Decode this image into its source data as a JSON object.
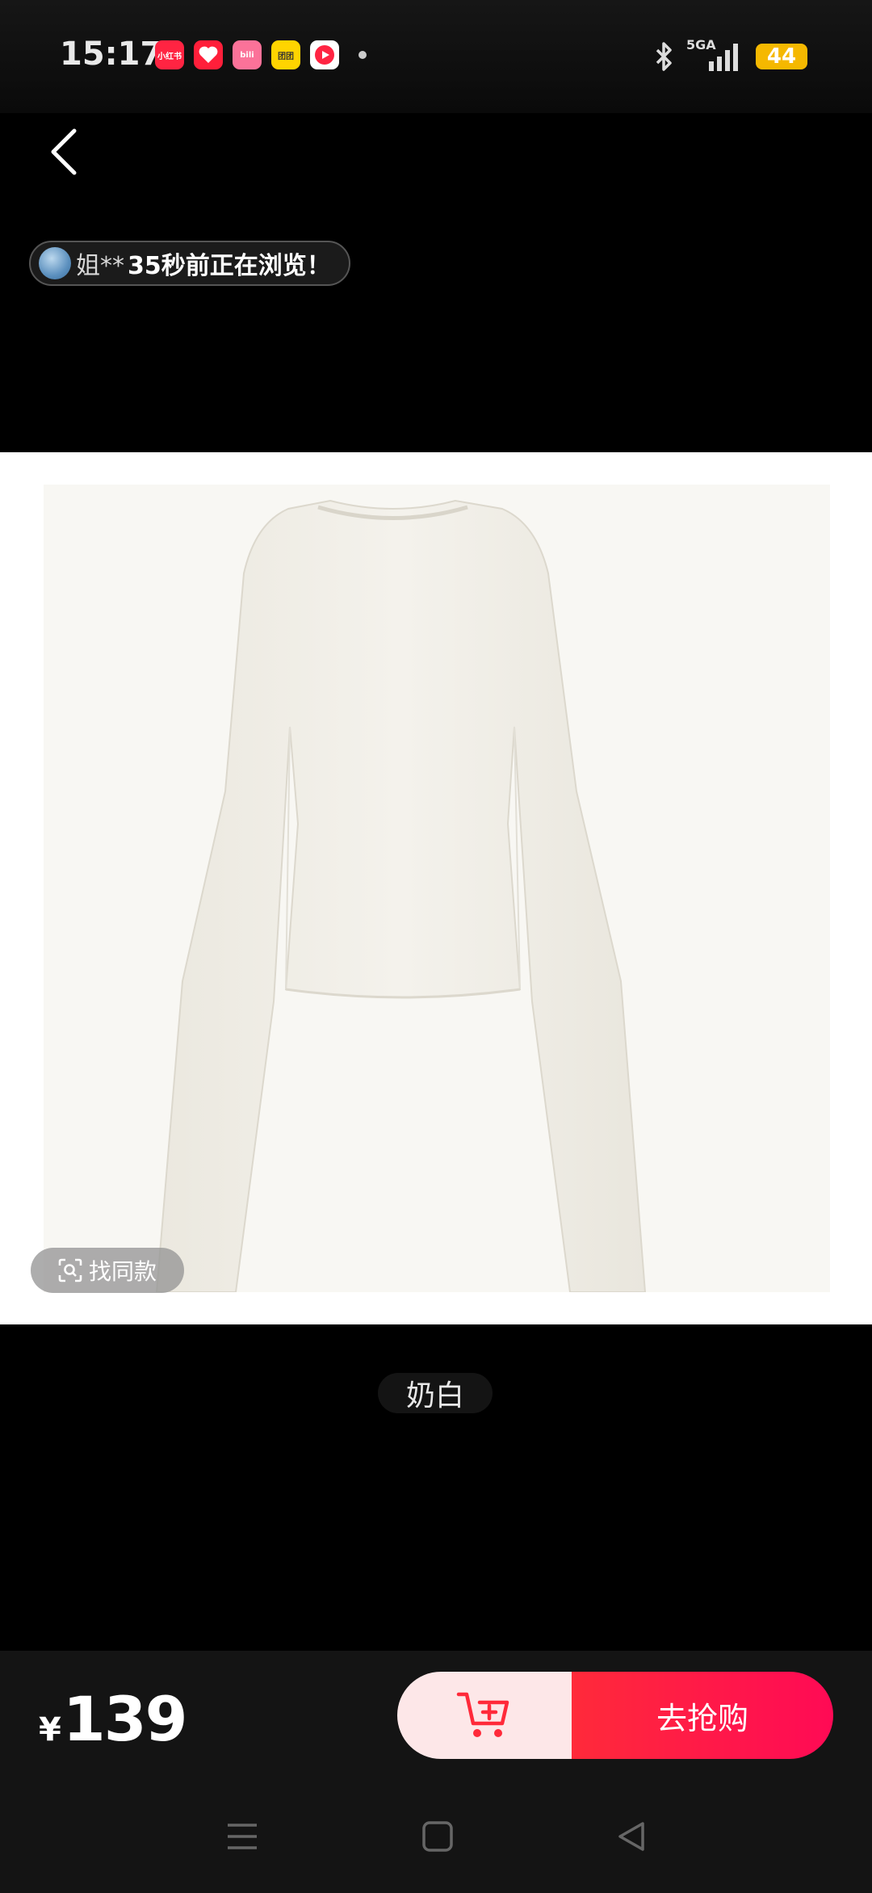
{
  "status_bar": {
    "time": "15:17",
    "apps": [
      {
        "icon": "xiaohongshu-icon",
        "label": "小红书",
        "color": "#ff2442"
      },
      {
        "icon": "heart-app-icon",
        "label": "",
        "color": "#ff1f3a"
      },
      {
        "icon": "bilibili-icon",
        "label": "bili",
        "color": "#fb7299"
      },
      {
        "icon": "tuantuan-icon",
        "label": "团团",
        "color": "#ffd400"
      },
      {
        "icon": "video-app-icon",
        "label": "",
        "color": "#ffffff"
      }
    ],
    "network": "5GA",
    "battery": "44"
  },
  "browsing_notice": {
    "name": "姐**",
    "text": "35秒前正在浏览！"
  },
  "product": {
    "image_icon": "white-long-sleeve-top",
    "find_same_label": "找同款"
  },
  "variant": {
    "label": "奶白"
  },
  "bottom_bar": {
    "currency": "¥",
    "price": "139",
    "cart_icon": "add-to-cart-icon",
    "buy_label": "去抢购",
    "buy_color": "#ff1a4a"
  },
  "nav": {
    "menu_icon": "menu-icon",
    "home_icon": "home-icon",
    "back_icon": "back-triangle-icon"
  }
}
